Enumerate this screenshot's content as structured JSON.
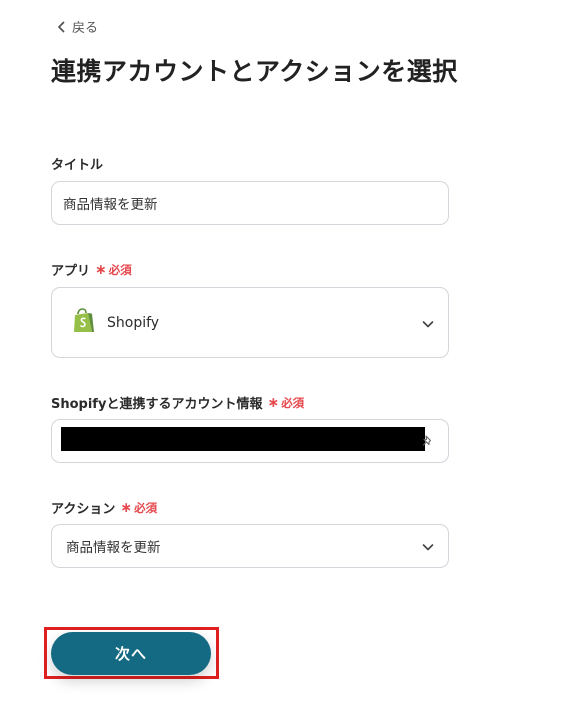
{
  "header": {
    "back_label": "戻る",
    "title": "連携アカウントとアクションを選択"
  },
  "fields": {
    "title": {
      "label": "タイトル",
      "value": "商品情報を更新"
    },
    "app": {
      "label": "アプリ",
      "required_label": "必須",
      "value": "Shopify"
    },
    "account": {
      "label": "Shopifyと連携するアカウント情報",
      "required_label": "必須"
    },
    "action": {
      "label": "アクション",
      "required_label": "必須",
      "value": "商品情報を更新"
    }
  },
  "footer": {
    "next_label": "次へ"
  },
  "colors": {
    "primary_button": "#146a82",
    "required": "#e5484d",
    "highlight_border": "#e02020",
    "shopify_green": "#95bf47"
  },
  "icons": {
    "back": "chevron-left-icon",
    "dropdown": "chevron-down-icon",
    "app_logo": "shopify-logo-icon",
    "account_pin": "pin-icon"
  }
}
